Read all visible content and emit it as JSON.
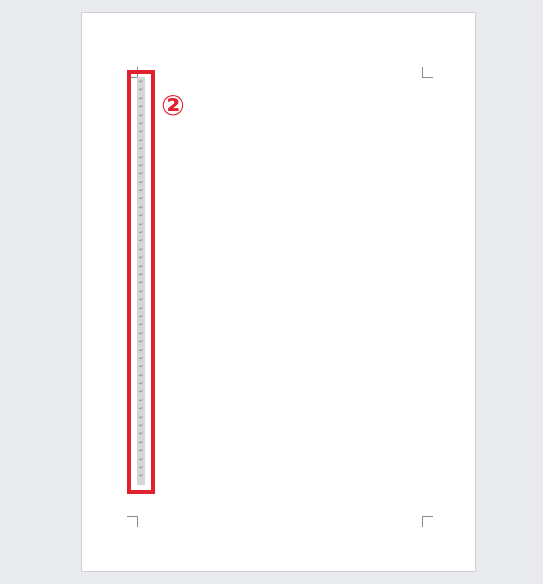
{
  "document": {
    "paragraph_mark": "↵",
    "paragraph_mark_count": 48
  },
  "annotation": {
    "step_label": "②",
    "highlight_color": "#e0212e"
  },
  "colors": {
    "background": "#e8eaed",
    "page": "#ffffff",
    "selection": "#d6d6d6"
  }
}
